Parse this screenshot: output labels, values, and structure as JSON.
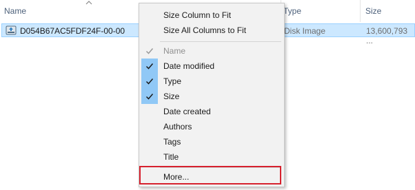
{
  "columns": {
    "name": "Name",
    "type": "Type",
    "size": "Size"
  },
  "file": {
    "name": "D054B67AC5FDF24F-00-00",
    "type": "Disk Image",
    "size": "13,600,793 ..."
  },
  "menu": {
    "size_column": "Size Column to Fit",
    "size_all": "Size All Columns to Fit",
    "items": [
      {
        "label": "Name",
        "checked": true,
        "disabled": true
      },
      {
        "label": "Date modified",
        "checked": true,
        "disabled": false
      },
      {
        "label": "Type",
        "checked": true,
        "disabled": false
      },
      {
        "label": "Size",
        "checked": true,
        "disabled": false
      },
      {
        "label": "Date created",
        "checked": false,
        "disabled": false
      },
      {
        "label": "Authors",
        "checked": false,
        "disabled": false
      },
      {
        "label": "Tags",
        "checked": false,
        "disabled": false
      },
      {
        "label": "Title",
        "checked": false,
        "disabled": false
      }
    ],
    "more": "More..."
  },
  "colors": {
    "selection": "#cce8ff",
    "check_highlight": "#90c8f6",
    "annotation": "#d6202d"
  },
  "icons": {
    "file": "disk-image-icon",
    "sort": "sort-up-arrow-icon",
    "check": "checkmark-icon"
  }
}
